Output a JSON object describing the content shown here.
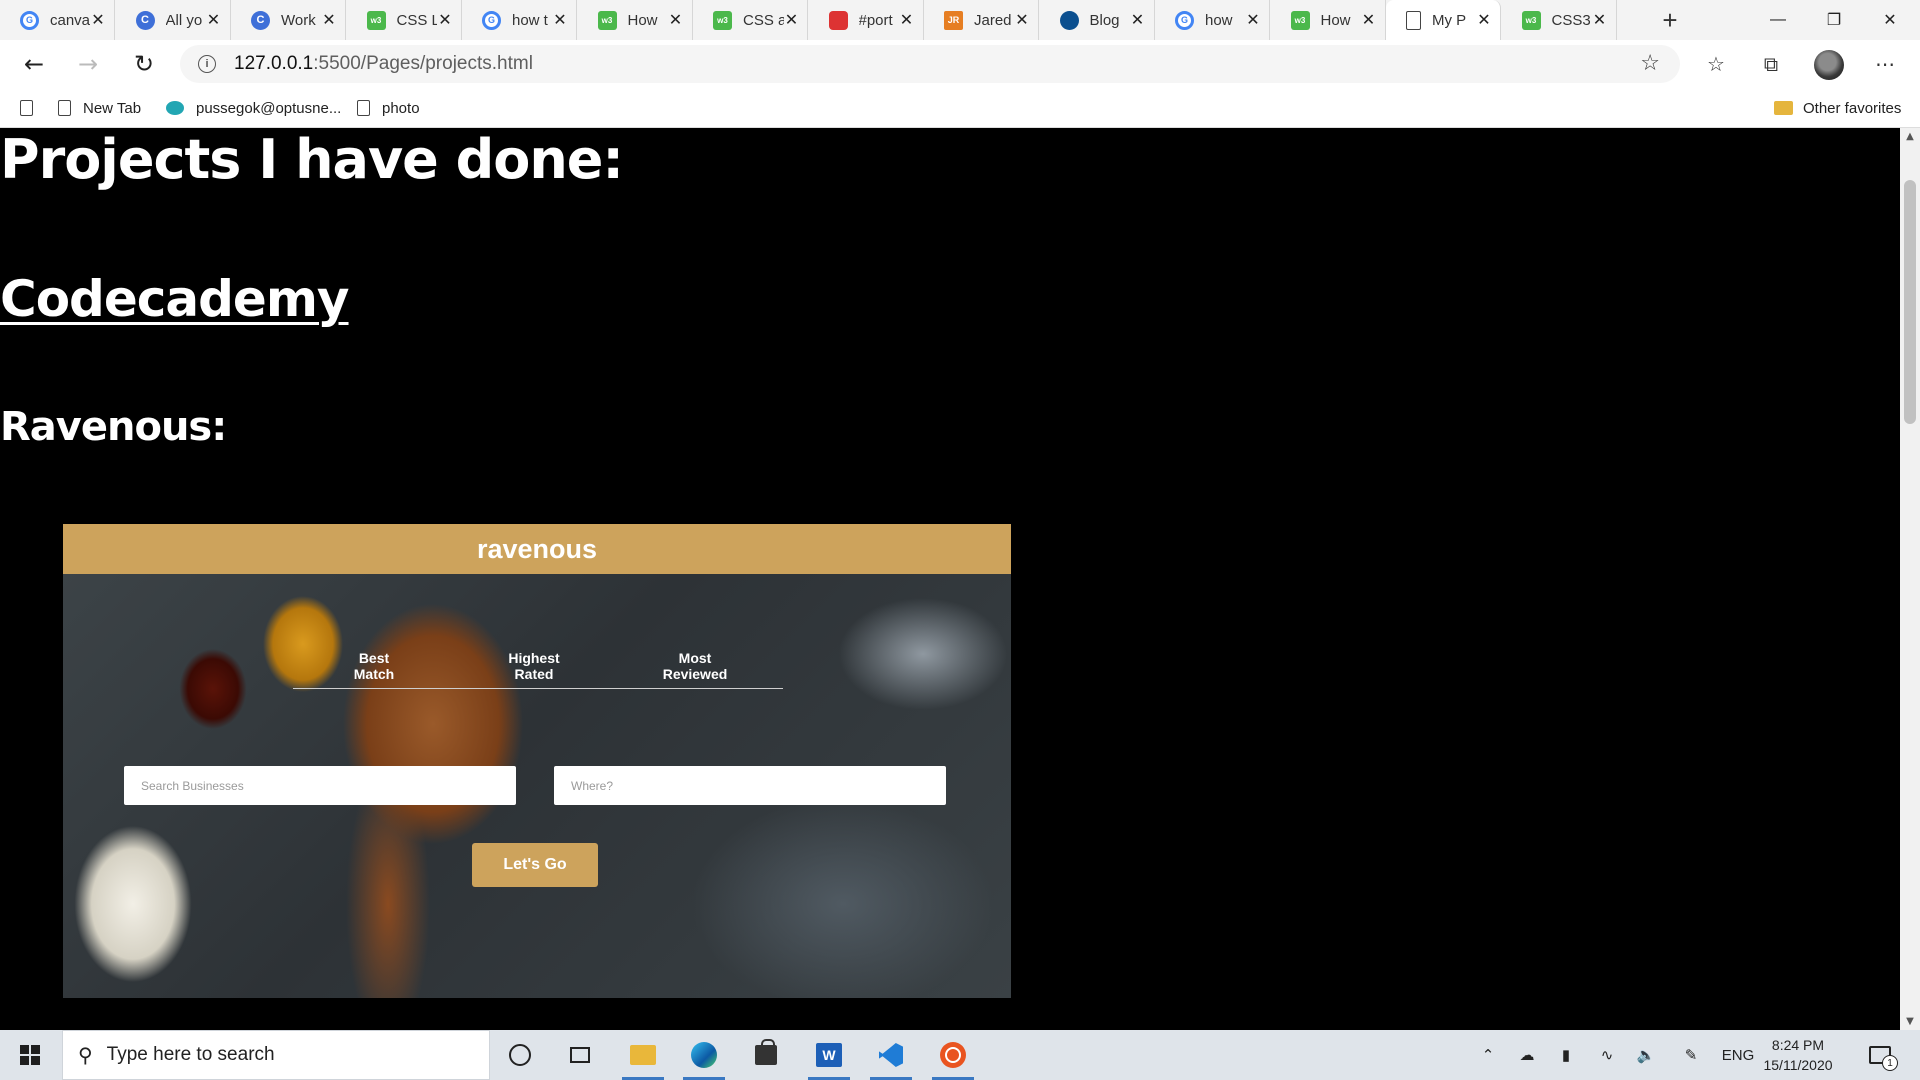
{
  "browser": {
    "tabs": [
      {
        "title": "canva",
        "icon": "google-icon",
        "active": false
      },
      {
        "title": "All yo",
        "icon": "codecademy-icon",
        "active": false
      },
      {
        "title": "Work",
        "icon": "codecademy-icon",
        "active": false
      },
      {
        "title": "CSS L",
        "icon": "w3schools-icon",
        "active": false
      },
      {
        "title": "how t",
        "icon": "google-icon",
        "active": false
      },
      {
        "title": "How",
        "icon": "w3schools-icon",
        "active": false
      },
      {
        "title": "CSS a",
        "icon": "w3schools-icon",
        "active": false
      },
      {
        "title": "#port",
        "icon": "recording-icon",
        "active": false
      },
      {
        "title": "Jared",
        "icon": "jared-icon",
        "active": false
      },
      {
        "title": "Blog",
        "icon": "blog-icon",
        "active": false
      },
      {
        "title": "how",
        "icon": "google-icon",
        "active": false
      },
      {
        "title": "How",
        "icon": "w3schools-icon",
        "active": false
      },
      {
        "title": "My P",
        "icon": "page-icon",
        "active": true
      },
      {
        "title": "CSS3",
        "icon": "w3schools-icon",
        "active": false
      }
    ],
    "address": {
      "host": "127.0.0.1",
      "path": ":5500/Pages/projects.html"
    },
    "bookmarks": [
      {
        "label": "New Tab",
        "icon": "page-icon"
      },
      {
        "label": "pussegok@optusne...",
        "icon": "optus-icon"
      },
      {
        "label": "photo",
        "icon": "page-icon"
      }
    ],
    "other_favorites": "Other favorites"
  },
  "page": {
    "heading": "Projects I have done:",
    "codecademy_link": "Codecademy",
    "ravenous_heading": "Ravenous:",
    "ravenous": {
      "brand": "ravenous",
      "sort_options": [
        {
          "line1": "Best",
          "line2": "Match"
        },
        {
          "line1": "Highest",
          "line2": "Rated"
        },
        {
          "line1": "Most",
          "line2": "Reviewed"
        }
      ],
      "search_placeholder": "Search Businesses",
      "where_placeholder": "Where?",
      "submit_label": "Let's Go"
    }
  },
  "taskbar": {
    "search_placeholder": "Type here to search",
    "apps": [
      "cortana-icon",
      "task-view-icon",
      "file-explorer-icon",
      "edge-icon",
      "store-icon",
      "word-icon",
      "vscode-icon",
      "ubuntu-icon"
    ],
    "language": "ENG",
    "time": "8:24 PM",
    "date": "15/11/2020",
    "notification_count": "1"
  },
  "colors": {
    "page_bg": "#000000",
    "ravenous_gold": "#cda35c",
    "active_indicator": "#3a78c2"
  }
}
